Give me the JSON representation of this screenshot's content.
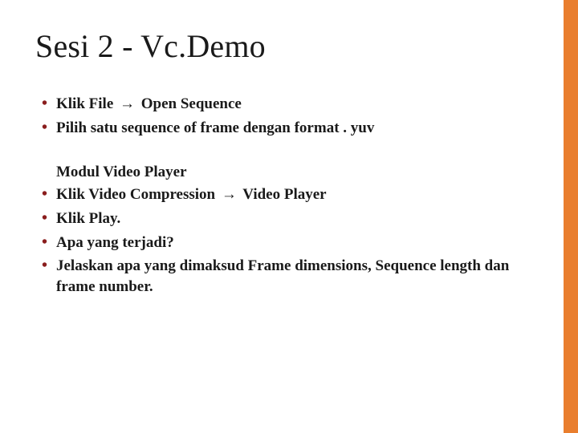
{
  "arrow_glyph": "→",
  "title": "Sesi 2 - Vc.Demo",
  "list1": [
    {
      "pre": "Klik File ",
      "post": " Open Sequence",
      "has_arrow": true
    },
    {
      "pre": "Pilih satu sequence of frame dengan format . yuv",
      "post": "",
      "has_arrow": false
    }
  ],
  "subhead": "Modul Video Player",
  "list2": [
    {
      "pre": "Klik Video Compression ",
      "post": " Video Player",
      "has_arrow": true
    },
    {
      "pre": "Klik Play.",
      "post": "",
      "has_arrow": false
    },
    {
      "pre": "Apa yang terjadi?",
      "post": "",
      "has_arrow": false
    },
    {
      "pre": "Jelaskan apa yang dimaksud Frame dimensions, Sequence length dan frame number.",
      "post": "",
      "has_arrow": false
    }
  ]
}
